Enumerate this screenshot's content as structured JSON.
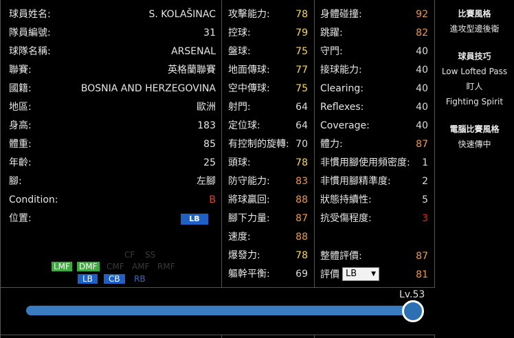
{
  "info": [
    {
      "label": "球員姓名:",
      "value": "S. KOLAŠINAC"
    },
    {
      "label": "隊員編號:",
      "value": "31"
    },
    {
      "label": "球隊名稱:",
      "value": "ARSENAL"
    },
    {
      "label": "聯賽:",
      "value": "英格蘭聯賽"
    },
    {
      "label": "國籍:",
      "value": "BOSNIA AND HERZEGOVINA"
    },
    {
      "label": "地區:",
      "value": "歐洲"
    },
    {
      "label": "身高:",
      "value": "183"
    },
    {
      "label": "體重:",
      "value": "85"
    },
    {
      "label": "年齡:",
      "value": "25"
    },
    {
      "label": "腳:",
      "value": "左腳"
    },
    {
      "label": "Condition:",
      "value": "B"
    },
    {
      "label": "位置:",
      "value": "LB"
    }
  ],
  "positions": {
    "lmf": "LMF",
    "dmf": "DMF",
    "cmf": "CMF",
    "amf": "AMF",
    "rmf": "RMF",
    "lb": "LB",
    "cb": "CB",
    "rb": "RB",
    "top1": "CF",
    "top2": "SS"
  },
  "stats_mid": [
    {
      "label": "攻擊能力:",
      "value": "78",
      "color": "yellow"
    },
    {
      "label": "控球:",
      "value": "79",
      "color": "yellow"
    },
    {
      "label": "盤球:",
      "value": "75",
      "color": "yellow"
    },
    {
      "label": "地面傳球:",
      "value": "77",
      "color": "yellow"
    },
    {
      "label": "空中傳球:",
      "value": "75",
      "color": "yellow"
    },
    {
      "label": "射門:",
      "value": "64",
      "color": "gray"
    },
    {
      "label": "定位球:",
      "value": "64",
      "color": "gray"
    },
    {
      "label": "有控制的旋轉:",
      "value": "70",
      "color": "gray"
    },
    {
      "label": "頭球:",
      "value": "78",
      "color": "yellow"
    },
    {
      "label": "防守能力:",
      "value": "83",
      "color": "orange"
    },
    {
      "label": "將球贏回:",
      "value": "88",
      "color": "orange"
    },
    {
      "label": "腳下力量:",
      "value": "87",
      "color": "orange"
    },
    {
      "label": "速度:",
      "value": "88",
      "color": "orange"
    },
    {
      "label": "爆發力:",
      "value": "78",
      "color": "yellow"
    },
    {
      "label": "軀幹平衡:",
      "value": "69",
      "color": "gray"
    }
  ],
  "stats_right": [
    {
      "label": "身體碰撞:",
      "value": "92",
      "color": "orange"
    },
    {
      "label": "跳躍:",
      "value": "82",
      "color": "orange"
    },
    {
      "label": "守門:",
      "value": "40",
      "color": "gray"
    },
    {
      "label": "接球能力:",
      "value": "40",
      "color": "gray"
    },
    {
      "label": "Clearing:",
      "value": "40",
      "color": "gray"
    },
    {
      "label": "Reflexes:",
      "value": "40",
      "color": "gray"
    },
    {
      "label": "Coverage:",
      "value": "40",
      "color": "gray"
    },
    {
      "label": "體力:",
      "value": "87",
      "color": "orange"
    },
    {
      "label": "非慣用腳使用頻密度:",
      "value": "1",
      "color": "gray"
    },
    {
      "label": "非慣用腳精準度:",
      "value": "2",
      "color": "gray"
    },
    {
      "label": "狀態持續性:",
      "value": "5",
      "color": "gray"
    },
    {
      "label": "抗受傷程度:",
      "value": "3",
      "color": "red"
    }
  ],
  "overall": {
    "label": "整體評價:",
    "value": "87"
  },
  "rating": {
    "label": "評價",
    "selected": "LB",
    "value": "81"
  },
  "sidebar": {
    "style_title": "比賽風格",
    "style_value": "進攻型邊後衛",
    "skills_title": "球員技巧",
    "skills": [
      "Low Lofted Pass",
      "盯人",
      "Fighting Spirit"
    ],
    "com_title": "電腦比賽風格",
    "com_value": "快速傳中"
  },
  "level": {
    "label": "Lv.53",
    "fraction": 1.0
  },
  "colors": {
    "yellow": "#ffde2b",
    "orange": "#f39a35",
    "red": "#ee2020",
    "badge_blue": "#1e60c6",
    "badge_green": "#3ea93e"
  }
}
